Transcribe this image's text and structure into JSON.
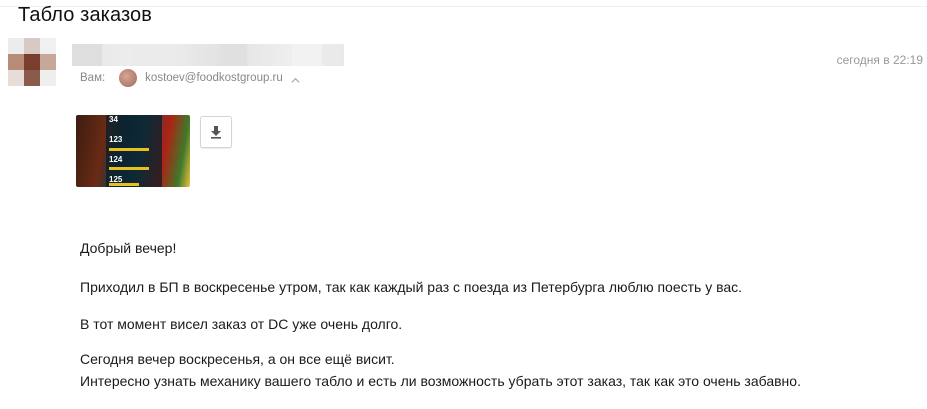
{
  "message": {
    "subject": "Табло заказов",
    "date": "сегодня в 22:19",
    "to_label": "Вам:",
    "to_email": "kostoev@foodkostgroup.ru",
    "attachment": {
      "icon": "image-thumbnail",
      "numbers": [
        "34",
        "123",
        "124",
        "125"
      ]
    },
    "body": {
      "greeting": "Добрый вечер!",
      "p1": "Приходил в БП в воскресенье утром, так как каждый раз с поезда из Петербурга люблю поесть у вас.",
      "p2": "В тот момент висел заказ от DC уже очень долго.",
      "p3_line1": "Сегодня вечер воскресенья, а он все ещё висит.",
      "p3_line2": "Интересно узнать механику вашего табло и есть ли возможность убрать этот заказ, так как это очень забавно."
    }
  },
  "colors": {
    "muted": "#999999",
    "text": "#1a1a1a"
  }
}
